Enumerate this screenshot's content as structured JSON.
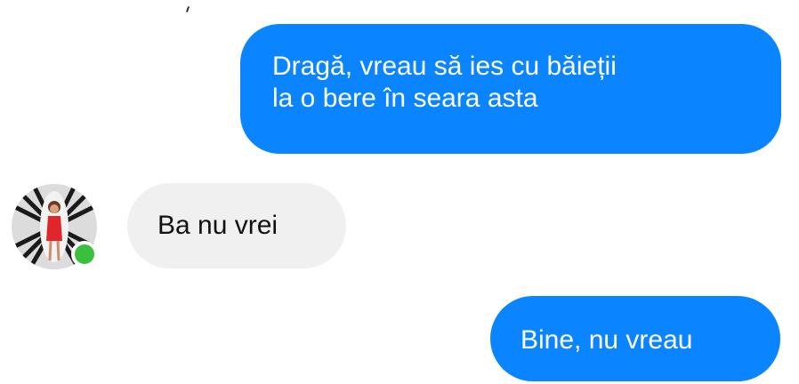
{
  "conversation": {
    "messages": [
      {
        "direction": "outgoing",
        "text": "Dragă, vreau să ies cu băieții\nla o bere în seara asta"
      },
      {
        "direction": "incoming",
        "text": "Ba nu vrei"
      },
      {
        "direction": "outgoing",
        "text": "Bine, nu vreau"
      }
    ],
    "contact": {
      "online": true,
      "avatar_icon": "profile-photo-icon",
      "presence_icon": "online-dot-icon"
    }
  },
  "colors": {
    "outgoing_bubble": "#0a84ff",
    "incoming_bubble": "#f0f0f0",
    "presence_dot": "#3cbf3c"
  }
}
